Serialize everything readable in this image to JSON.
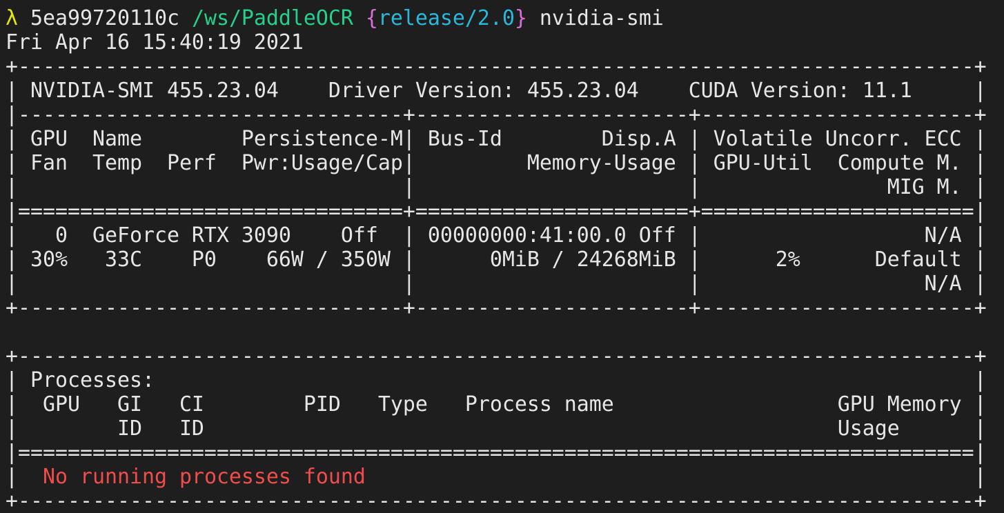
{
  "prompt": {
    "lambda": "λ",
    "host": "5ea99720110c",
    "path": "/ws/PaddleOCR",
    "brace_open": "{",
    "branch": "release/2.0",
    "brace_close": "}",
    "command": "nvidia-smi"
  },
  "timestamp": "Fri Apr 16 15:40:19 2021",
  "smi": {
    "header_border_top": "+-----------------------------------------------------------------------------+",
    "header_versions": "| NVIDIA-SMI 455.23.04    Driver Version: 455.23.04    CUDA Version: 11.1     |",
    "header_divider": "|-------------------------------+----------------------+----------------------+",
    "col_header_1": "| GPU  Name        Persistence-M| Bus-Id        Disp.A | Volatile Uncorr. ECC |",
    "col_header_2": "| Fan  Temp  Perf  Pwr:Usage/Cap|         Memory-Usage | GPU-Util  Compute M. |",
    "col_header_3": "|                               |                      |               MIG M. |",
    "col_header_sep": "|===============================+======================+======================|",
    "gpu_row_1": "|   0  GeForce RTX 3090    Off  | 00000000:41:00.0 Off |                  N/A |",
    "gpu_row_2": "| 30%   33C    P0    66W / 350W |      0MiB / 24268MiB |      2%      Default |",
    "gpu_row_3": "|                               |                      |                  N/A |",
    "gpu_border_bottom": "+-------------------------------+----------------------+----------------------+",
    "blank": " ",
    "proc_border_top": "+-----------------------------------------------------------------------------+",
    "proc_title": "| Processes:                                                                  |",
    "proc_header_1": "|  GPU   GI   CI        PID   Type   Process name                  GPU Memory |",
    "proc_header_2": "|        ID   ID                                                   Usage      |",
    "proc_sep": "|=============================================================================|",
    "proc_empty_left": "|  ",
    "proc_empty_msg": "No running processes found",
    "proc_empty_right": "                                                 |",
    "proc_border_bottom": "+-----------------------------------------------------------------------------+"
  },
  "colors": {
    "background": "#1e1e1e",
    "text": "#e6e6e6",
    "lambda": "#e5e510",
    "path": "#23d18b",
    "brace": "#d670d6",
    "branch": "#29b8db",
    "error": "#f14c4c"
  }
}
